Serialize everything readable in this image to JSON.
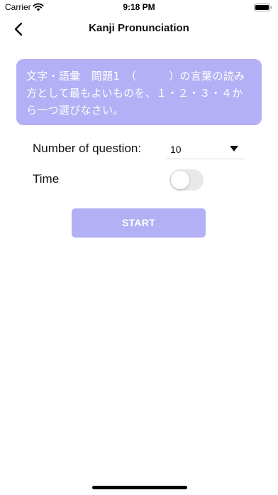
{
  "status_bar": {
    "carrier": "Carrier",
    "time": "9:18 PM",
    "wifi_icon": "wifi-icon",
    "battery_icon": "battery-icon"
  },
  "nav": {
    "title": "Kanji Pronunciation",
    "back_icon": "chevron-left-icon"
  },
  "instruction": {
    "text": "文字・語彙　問題1　（　　　）の言葉の読み方として最もよいものを、１・２・３・４から一つ選びなさい。"
  },
  "settings": {
    "number_label": "Number of question:",
    "number_value": "10",
    "time_label": "Time",
    "time_enabled": false
  },
  "actions": {
    "start_label": "START"
  },
  "colors": {
    "accent": "#b3b0f5",
    "toggle_off": "#e9e9eb"
  }
}
